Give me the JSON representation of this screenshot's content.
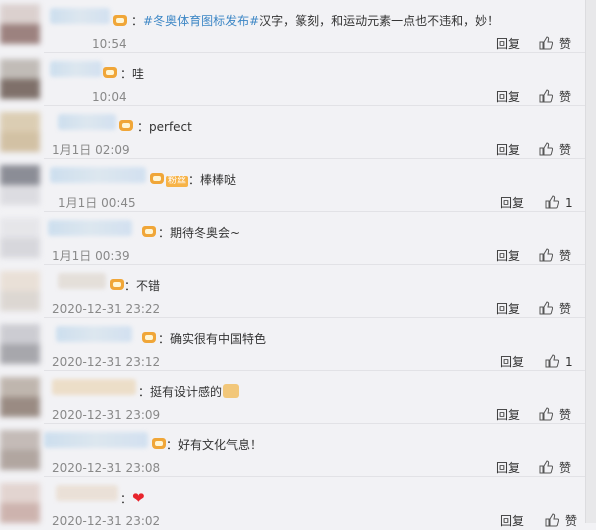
{
  "comments": [
    {
      "prefix_topic": "#冬奥体育图标发布#",
      "text": "汉字，篆刻，和运动元素一点也不违和，妙！",
      "time": "10:54",
      "reply": "回复",
      "like": "赞"
    },
    {
      "text": "哇",
      "time": "10:04",
      "reply": "回复",
      "like": "赞"
    },
    {
      "text": "perfect",
      "time": "1月1日 02:09",
      "reply": "回复",
      "like": "赞"
    },
    {
      "vip_tag": "粉丝",
      "text": "棒棒哒",
      "time": "1月1日 00:45",
      "reply": "回复",
      "like": "1"
    },
    {
      "text": "期待冬奥会~",
      "time": "1月1日 00:39",
      "reply": "回复",
      "like": "赞"
    },
    {
      "text": "不错",
      "time": "2020-12-31 23:22",
      "reply": "回复",
      "like": "赞"
    },
    {
      "text": "确实很有中国特色",
      "time": "2020-12-31 23:12",
      "reply": "回复",
      "like": "1"
    },
    {
      "text": "挺有设计感的",
      "time": "2020-12-31 23:09",
      "reply": "回复",
      "like": "赞"
    },
    {
      "text": "好有文化气息！",
      "time": "2020-12-31 23:08",
      "reply": "回复",
      "like": "赞"
    },
    {
      "text": "",
      "time": "2020-12-31 23:02",
      "reply": "回复",
      "like": "赞"
    }
  ],
  "colors": {
    "topic": "#3c86c5",
    "time": "#888888",
    "heart": "#e8242c",
    "badge": "#f0a638"
  },
  "icons": [
    "vip-badge-icon",
    "thumbs-up-icon",
    "heart-emoji-icon",
    "clap-emoji-icon"
  ]
}
